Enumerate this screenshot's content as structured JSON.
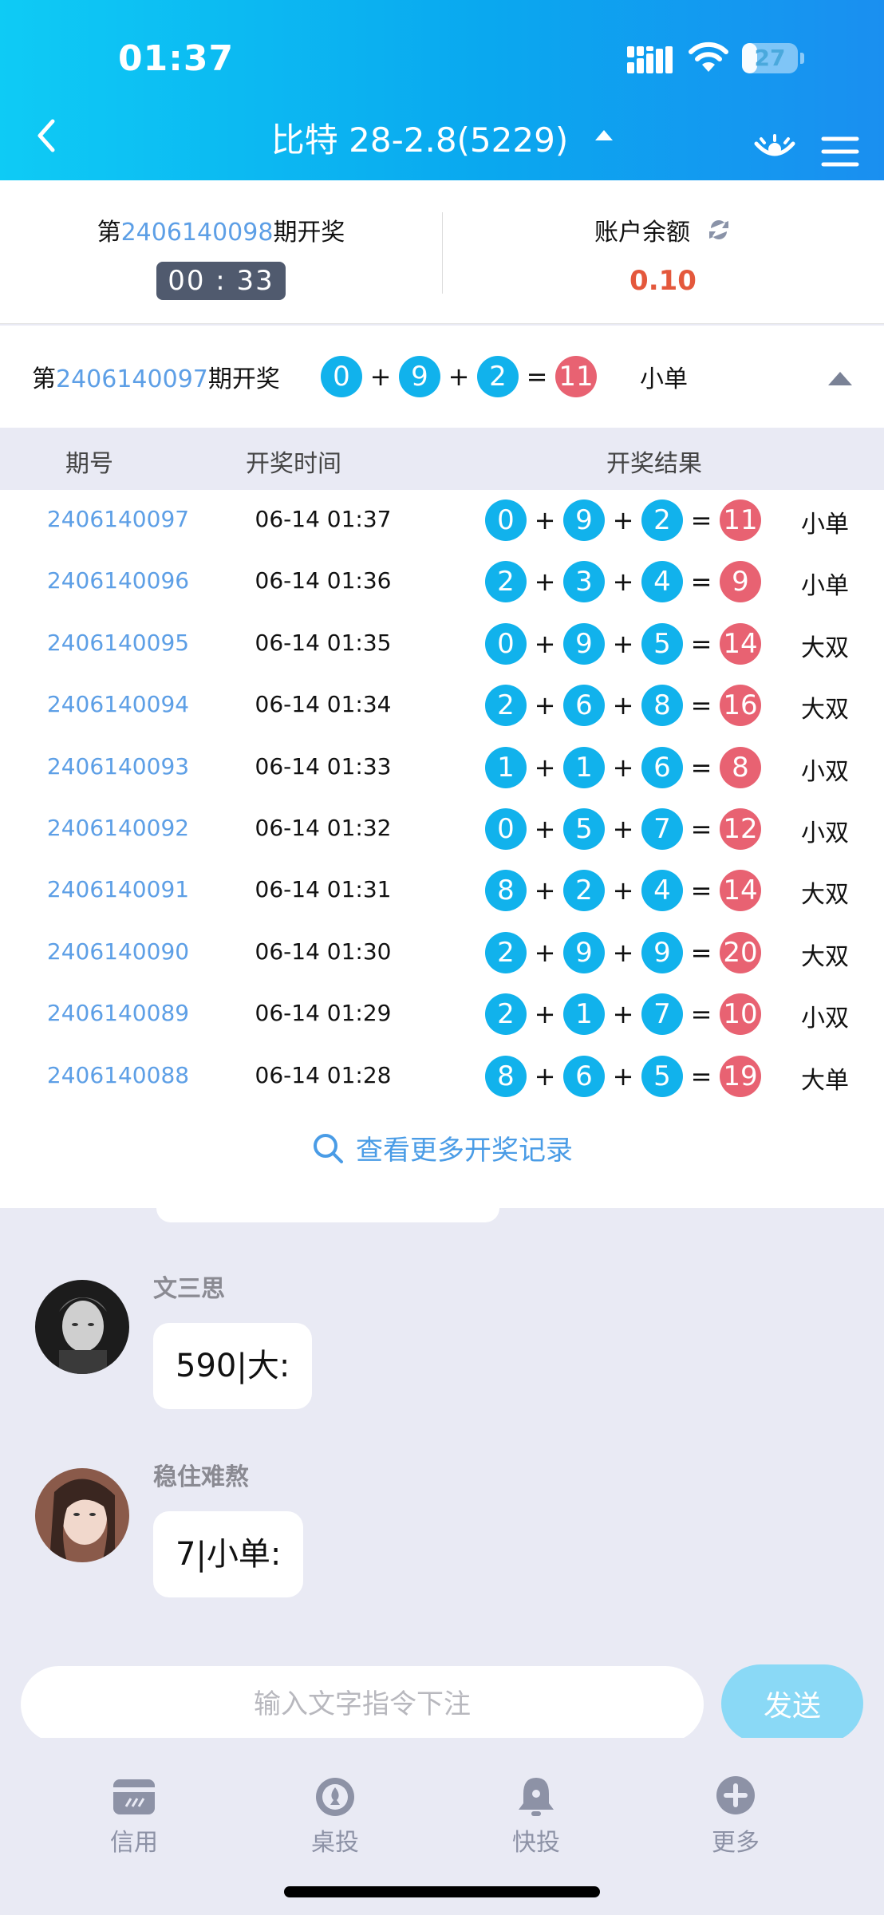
{
  "status_bar": {
    "time": "01:37",
    "battery_level": "27",
    "battery_fraction": 0.27
  },
  "header": {
    "title": "比特 28-2.8(5229)"
  },
  "current_draw": {
    "prefix": "第",
    "period": "2406140098",
    "suffix": "期开奖",
    "countdown": "00 : 33"
  },
  "account": {
    "label": "账户余额",
    "balance": "0.10"
  },
  "last_draw": {
    "prefix": "第",
    "period": "2406140097",
    "suffix": "期开奖",
    "balls": [
      "0",
      "9",
      "2"
    ],
    "sum": "11",
    "result_type": "小单",
    "plus": "+",
    "equals": "="
  },
  "table": {
    "headers": {
      "period": "期号",
      "time": "开奖时间",
      "result": "开奖结果"
    },
    "rows": [
      {
        "period": "2406140097",
        "time": "06-14 01:37",
        "balls": [
          "0",
          "9",
          "2"
        ],
        "sum": "11",
        "type": "小单"
      },
      {
        "period": "2406140096",
        "time": "06-14 01:36",
        "balls": [
          "2",
          "3",
          "4"
        ],
        "sum": "9",
        "type": "小单"
      },
      {
        "period": "2406140095",
        "time": "06-14 01:35",
        "balls": [
          "0",
          "9",
          "5"
        ],
        "sum": "14",
        "type": "大双"
      },
      {
        "period": "2406140094",
        "time": "06-14 01:34",
        "balls": [
          "2",
          "6",
          "8"
        ],
        "sum": "16",
        "type": "大双"
      },
      {
        "period": "2406140093",
        "time": "06-14 01:33",
        "balls": [
          "1",
          "1",
          "6"
        ],
        "sum": "8",
        "type": "小双"
      },
      {
        "period": "2406140092",
        "time": "06-14 01:32",
        "balls": [
          "0",
          "5",
          "7"
        ],
        "sum": "12",
        "type": "小双"
      },
      {
        "period": "2406140091",
        "time": "06-14 01:31",
        "balls": [
          "8",
          "2",
          "4"
        ],
        "sum": "14",
        "type": "大双"
      },
      {
        "period": "2406140090",
        "time": "06-14 01:30",
        "balls": [
          "2",
          "9",
          "9"
        ],
        "sum": "20",
        "type": "大双"
      },
      {
        "period": "2406140089",
        "time": "06-14 01:29",
        "balls": [
          "2",
          "1",
          "7"
        ],
        "sum": "10",
        "type": "小双"
      },
      {
        "period": "2406140088",
        "time": "06-14 01:28",
        "balls": [
          "8",
          "6",
          "5"
        ],
        "sum": "19",
        "type": "大单"
      }
    ],
    "more_link": "查看更多开奖记录"
  },
  "chat": {
    "messages": [
      {
        "sender": "文三思",
        "text": "590|大:"
      },
      {
        "sender": "稳住难熬",
        "text": "7|小单:"
      }
    ]
  },
  "input": {
    "placeholder": "输入文字指令下注",
    "value": "",
    "send_label": "发送"
  },
  "tabs": [
    {
      "label": "信用",
      "icon": "card-icon"
    },
    {
      "label": "桌投",
      "icon": "chip-icon"
    },
    {
      "label": "快投",
      "icon": "bell-icon"
    },
    {
      "label": "更多",
      "icon": "plus-circle-icon"
    }
  ]
}
